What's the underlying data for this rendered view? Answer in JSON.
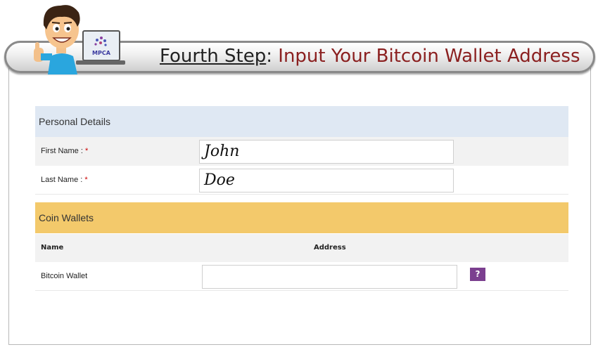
{
  "banner": {
    "step_prefix": "Fourth Step",
    "colon": ":",
    "step_title": "Input Your Bitcoin Wallet Address",
    "logo_text": "MPCA"
  },
  "personal": {
    "section_title": "Personal Details",
    "first_name_label": "First Name :",
    "first_name_value": "John",
    "last_name_label": "Last Name :",
    "last_name_value": "Doe",
    "required_mark": "*"
  },
  "coins": {
    "section_title": "Coin Wallets",
    "col_name": "Name",
    "col_address": "Address",
    "rows": [
      {
        "name": "Bitcoin Wallet",
        "address": ""
      }
    ],
    "help_label": "?"
  },
  "colors": {
    "banner_title": "#8b2020",
    "personal_header_bg": "#dfe8f3",
    "coin_header_bg": "#f3c96b",
    "help_button": "#7b3f8f",
    "required": "#cc0000"
  }
}
